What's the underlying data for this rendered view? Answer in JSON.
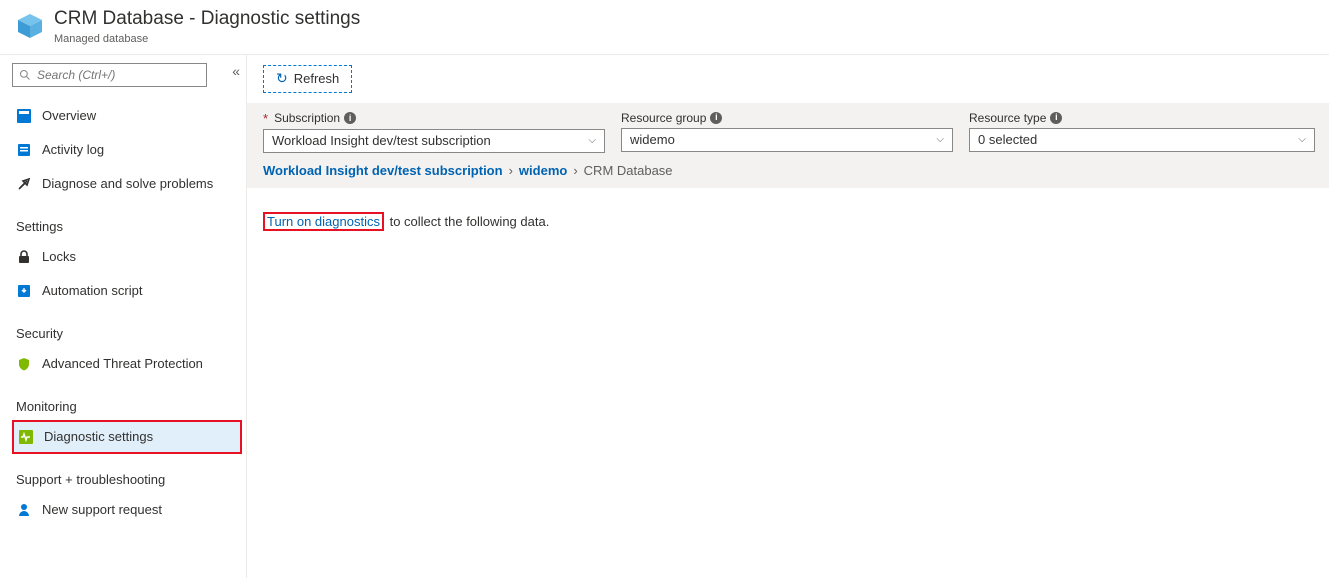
{
  "header": {
    "title": "CRM Database - Diagnostic settings",
    "subtitle": "Managed database"
  },
  "sidebar": {
    "search_placeholder": "Search (Ctrl+/)",
    "items_top": {
      "overview": "Overview",
      "activity_log": "Activity log",
      "diagnose": "Diagnose and solve problems"
    },
    "sections": {
      "settings": "Settings",
      "security": "Security",
      "monitoring": "Monitoring",
      "support": "Support + troubleshooting"
    },
    "items": {
      "locks": "Locks",
      "automation": "Automation script",
      "advanced_threat": "Advanced Threat Protection",
      "diagnostic": "Diagnostic settings",
      "new_support": "New support request"
    }
  },
  "toolbar": {
    "refresh": "Refresh"
  },
  "filters": {
    "subscription_label": "Subscription",
    "subscription_value": "Workload Insight dev/test subscription",
    "resource_group_label": "Resource group",
    "resource_group_value": "widemo",
    "resource_type_label": "Resource type",
    "resource_type_value": "0 selected"
  },
  "breadcrumb": {
    "l1": "Workload Insight dev/test subscription",
    "l2": "widemo",
    "l3": "CRM Database"
  },
  "content": {
    "turn_on": "Turn on diagnostics",
    "turn_on_suffix": " to collect the following data."
  }
}
